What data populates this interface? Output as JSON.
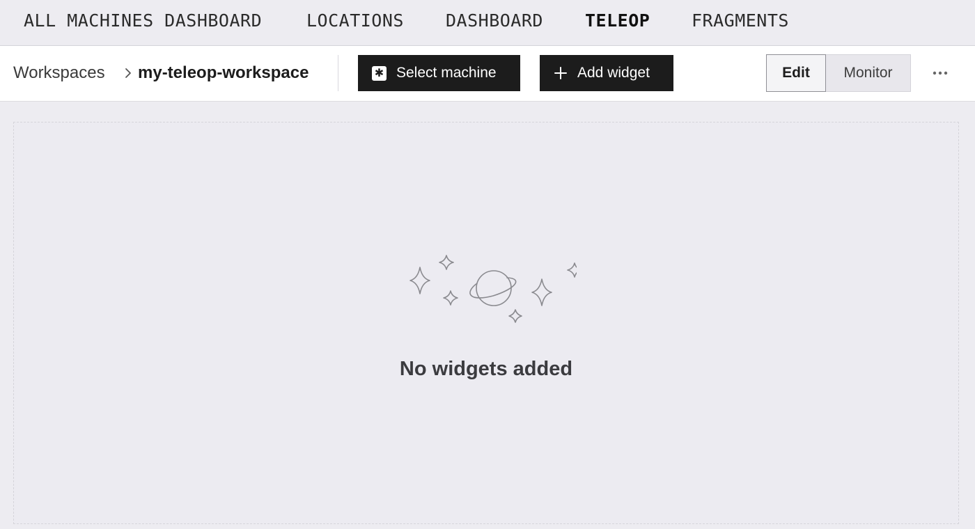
{
  "nav": {
    "items": [
      {
        "label": "ALL MACHINES DASHBOARD"
      },
      {
        "label": "LOCATIONS"
      },
      {
        "label": "DASHBOARD"
      },
      {
        "label": "TELEOP"
      },
      {
        "label": "FRAGMENTS"
      }
    ],
    "active": "TELEOP"
  },
  "breadcrumb": {
    "root": "Workspaces",
    "current": "my-teleop-workspace"
  },
  "toolbar": {
    "select_machine_label": "Select machine",
    "select_machine_icon": "asterisk-icon",
    "add_widget_label": "Add widget",
    "add_widget_icon": "plus-icon",
    "mode_edit_label": "Edit",
    "mode_monitor_label": "Monitor",
    "active_mode": "Edit",
    "more_icon": "ellipsis-icon"
  },
  "empty_state": {
    "illustration": "planet-stars-icon",
    "title": "No widgets added"
  },
  "colors": {
    "nav_bg": "#edecf1",
    "toolbar_bg": "#ffffff",
    "dark_button": "#1c1c1c",
    "canvas_bg": "#ecebf1",
    "illustration_stroke": "#8a8a8f"
  }
}
